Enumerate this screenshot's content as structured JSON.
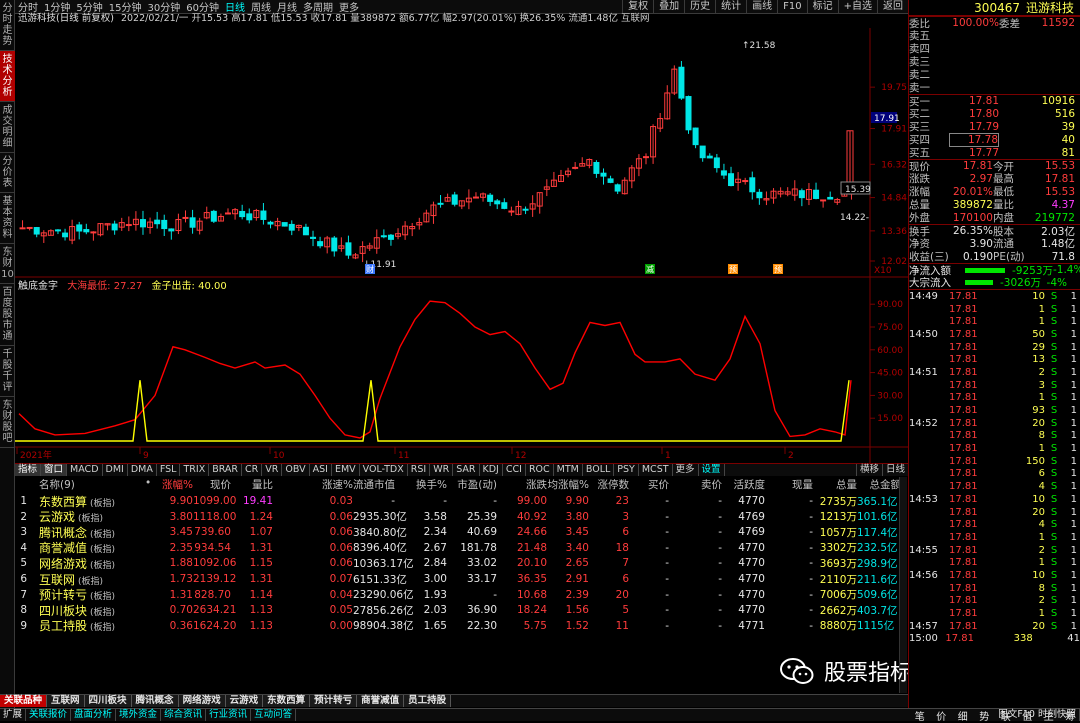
{
  "left_sidebar": [
    "分时走势",
    "技术分析",
    "成交明细",
    "分价表",
    "基本资料",
    "东财10",
    "百度股市通",
    "千股千评",
    "东财股吧"
  ],
  "periods": [
    "分时",
    "1分钟",
    "5分钟",
    "15分钟",
    "30分钟",
    "60分钟",
    "日线",
    "周线",
    "月线",
    "多周期",
    "更多"
  ],
  "active_period": "日线",
  "toolbar": [
    "复权",
    "叠加",
    "历史",
    "统计",
    "画线",
    "F10",
    "标记",
    "+自选",
    "返回"
  ],
  "info_title": "迅游科技(日线 前复权)",
  "info_line": "2022/02/21/一 开15.53 高17.81 低15.53 收17.81 量389872 额6.77亿 幅2.97(20.01%) 换26.35% 流通1.48亿 互联网",
  "kline": {
    "price_ticks": [
      "19.75",
      "17.91",
      "16.32",
      "14.84",
      "13.36",
      "12.02"
    ],
    "annotations": {
      "high": "21.58",
      "low": "11.91",
      "mid": "15.39",
      "last": "14.22"
    },
    "current_price_tag": "17.91",
    "zoom": "X10",
    "markers": [
      "财",
      "减",
      "预",
      "预"
    ]
  },
  "indicator": {
    "name": "触底金字",
    "line1": "大海最低: 27.27",
    "line2": "金子出击: 40.00",
    "ticks": [
      "90.00",
      "75.00",
      "60.00",
      "45.00",
      "30.00",
      "15.00"
    ],
    "color1": "#ff0000",
    "color2": "#ffff00"
  },
  "date_axis": [
    "2021年",
    "9",
    "10",
    "11",
    "12",
    "1",
    "2"
  ],
  "indicator_tabs": [
    "指标",
    "窗口",
    "MACD",
    "DMI",
    "DMA",
    "FSL",
    "TRIX",
    "BRAR",
    "CR",
    "VR",
    "OBV",
    "ASI",
    "EMV",
    "VOL-TDX",
    "RSI",
    "WR",
    "SAR",
    "KDJ",
    "CCI",
    "ROC",
    "MTM",
    "BOLL",
    "PSY",
    "MCST",
    "更多",
    "设置"
  ],
  "view_tabs": [
    "横移",
    "日线"
  ],
  "table": {
    "columns": [
      "",
      "名称(9)",
      "•",
      "涨幅%",
      "现价",
      "量比",
      "涨速%",
      "流通市值",
      "换手%",
      "市盈(动)",
      "涨跌",
      "均涨幅%",
      "涨停数",
      "买价",
      "卖价",
      "活跃度",
      "现量",
      "总量",
      "总金额"
    ],
    "rows": [
      [
        "1",
        "东数西算",
        "(板指)",
        "9.90",
        "1099.00",
        "19.41",
        "0.03",
        "-",
        "-",
        "-",
        "99.00",
        "9.90",
        "23",
        "-",
        "-",
        "4770",
        "-",
        "2735万",
        "365.1亿"
      ],
      [
        "2",
        "云游戏",
        "(板指)",
        "3.80",
        "1118.00",
        "1.24",
        "0.06",
        "2935.30亿",
        "3.58",
        "25.39",
        "40.92",
        "3.80",
        "3",
        "-",
        "-",
        "4769",
        "-",
        "1213万",
        "101.6亿"
      ],
      [
        "3",
        "腾讯概念",
        "(板指)",
        "3.45",
        "739.60",
        "1.07",
        "0.06",
        "3840.80亿",
        "2.34",
        "40.69",
        "24.66",
        "3.45",
        "6",
        "-",
        "-",
        "4769",
        "-",
        "1057万",
        "117.4亿"
      ],
      [
        "4",
        "商誉减值",
        "(板指)",
        "2.35",
        "934.54",
        "1.31",
        "0.06",
        "8396.40亿",
        "2.67",
        "181.78",
        "21.48",
        "3.40",
        "18",
        "-",
        "-",
        "4770",
        "-",
        "3302万",
        "232.5亿"
      ],
      [
        "5",
        "网络游戏",
        "(板指)",
        "1.88",
        "1092.06",
        "1.15",
        "0.06",
        "10363.17亿",
        "2.84",
        "33.02",
        "20.10",
        "2.65",
        "7",
        "-",
        "-",
        "4770",
        "-",
        "3693万",
        "298.9亿"
      ],
      [
        "6",
        "互联网",
        "(板指)",
        "1.73",
        "2139.12",
        "1.31",
        "0.07",
        "6151.33亿",
        "3.00",
        "33.17",
        "36.35",
        "2.91",
        "6",
        "-",
        "-",
        "4770",
        "-",
        "2110万",
        "211.6亿"
      ],
      [
        "7",
        "预计转亏",
        "(板指)",
        "1.31",
        "828.70",
        "1.14",
        "0.04",
        "23290.06亿",
        "1.93",
        "-",
        "10.68",
        "2.39",
        "20",
        "-",
        "-",
        "4770",
        "-",
        "7006万",
        "509.6亿"
      ],
      [
        "8",
        "四川板块",
        "(板指)",
        "0.70",
        "2634.21",
        "1.13",
        "0.05",
        "27856.26亿",
        "2.03",
        "36.90",
        "18.24",
        "1.56",
        "5",
        "-",
        "-",
        "4770",
        "-",
        "2662万",
        "403.7亿"
      ],
      [
        "9",
        "员工持股",
        "(板指)",
        "0.36",
        "1624.20",
        "1.13",
        "0.00",
        "98904.38亿",
        "1.65",
        "22.30",
        "5.75",
        "1.52",
        "11",
        "-",
        "-",
        "4771",
        "-",
        "8880万",
        "1115亿"
      ]
    ]
  },
  "bottom_tabs": [
    "关联品种",
    "互联网",
    "四川板块",
    "腾讯概念",
    "网络游戏",
    "云游戏",
    "东数西算",
    "预计转亏",
    "商誉减值",
    "员工持股"
  ],
  "status_bar": [
    "扩展",
    "关联报价",
    "盘面分析",
    "境外资金",
    "综合资讯",
    "行业资讯",
    "互动问答"
  ],
  "status_right": "图文F10 时刻快照",
  "stock": {
    "code": "300467",
    "name": "迅游科技",
    "weibi_label": "委比",
    "weibi": "100.00%",
    "weicha_label": "委差",
    "weicha": "11592",
    "sell": [
      [
        "卖五",
        "",
        ""
      ],
      [
        "卖四",
        "",
        ""
      ],
      [
        "卖三",
        "",
        ""
      ],
      [
        "卖二",
        "",
        ""
      ],
      [
        "卖一",
        "",
        ""
      ]
    ],
    "buy": [
      [
        "买一",
        "17.81",
        "10916"
      ],
      [
        "买二",
        "17.80",
        "516"
      ],
      [
        "买三",
        "17.79",
        "39"
      ],
      [
        "买四",
        "17.78",
        "40"
      ],
      [
        "买五",
        "17.77",
        "81"
      ]
    ],
    "quote": [
      [
        "现价",
        "17.81",
        "今开",
        "15.53"
      ],
      [
        "涨跌",
        "2.97",
        "最高",
        "17.81"
      ],
      [
        "涨幅",
        "20.01%",
        "最低",
        "15.53"
      ],
      [
        "总量",
        "389872",
        "量比",
        "4.37"
      ],
      [
        "外盘",
        "170100",
        "内盘",
        "219772"
      ]
    ],
    "quote2": [
      [
        "换手",
        "26.35%",
        "股本",
        "2.03亿"
      ],
      [
        "净资",
        "3.90",
        "流通",
        "1.48亿"
      ],
      [
        "收益(三)",
        "0.190",
        "PE(动)",
        "71.8"
      ]
    ],
    "flow": [
      [
        "净流入额",
        "-9253万",
        "-1.4%"
      ],
      [
        "大宗流入",
        "-3026万",
        "-4%"
      ]
    ],
    "ticks": [
      [
        "14:49",
        "17.81",
        "10",
        "S",
        "1"
      ],
      [
        "",
        "17.81",
        "1",
        "S",
        "1"
      ],
      [
        "",
        "17.81",
        "1",
        "S",
        "1"
      ],
      [
        "14:50",
        "17.81",
        "50",
        "S",
        "1"
      ],
      [
        "",
        "17.81",
        "29",
        "S",
        "1"
      ],
      [
        "",
        "17.81",
        "13",
        "S",
        "1"
      ],
      [
        "14:51",
        "17.81",
        "2",
        "S",
        "1"
      ],
      [
        "",
        "17.81",
        "3",
        "S",
        "1"
      ],
      [
        "",
        "17.81",
        "1",
        "S",
        "1"
      ],
      [
        "",
        "17.81",
        "93",
        "S",
        "1"
      ],
      [
        "14:52",
        "17.81",
        "20",
        "S",
        "1"
      ],
      [
        "",
        "17.81",
        "8",
        "S",
        "1"
      ],
      [
        "",
        "17.81",
        "1",
        "S",
        "1"
      ],
      [
        "",
        "17.81",
        "150",
        "S",
        "1"
      ],
      [
        "",
        "17.81",
        "6",
        "S",
        "1"
      ],
      [
        "",
        "17.81",
        "4",
        "S",
        "1"
      ],
      [
        "14:53",
        "17.81",
        "10",
        "S",
        "1"
      ],
      [
        "",
        "17.81",
        "20",
        "S",
        "1"
      ],
      [
        "",
        "17.81",
        "4",
        "S",
        "1"
      ],
      [
        "",
        "17.81",
        "1",
        "S",
        "1"
      ],
      [
        "14:55",
        "17.81",
        "2",
        "S",
        "1"
      ],
      [
        "",
        "17.81",
        "1",
        "S",
        "1"
      ],
      [
        "14:56",
        "17.81",
        "10",
        "S",
        "1"
      ],
      [
        "",
        "17.81",
        "8",
        "S",
        "1"
      ],
      [
        "",
        "17.81",
        "2",
        "S",
        "1"
      ],
      [
        "",
        "17.81",
        "1",
        "S",
        "1"
      ],
      [
        "14:57",
        "17.81",
        "20",
        "S",
        "1"
      ],
      [
        "15:00",
        "17.81",
        "338",
        "",
        ""
      ]
    ],
    "ticks_last_count": "41",
    "right_tabs": [
      "笔",
      "价",
      "细",
      "势",
      "联",
      "值",
      "主",
      "筹"
    ]
  },
  "watermark": "股票指标源码分享"
}
